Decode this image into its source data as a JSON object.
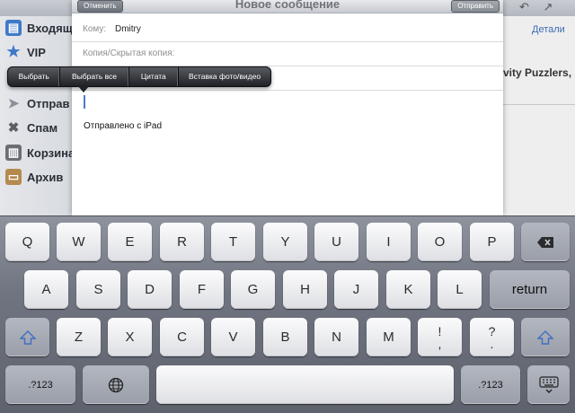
{
  "sidebar": {
    "folders": [
      {
        "label": "Входящ",
        "icon": "inbox-icon",
        "color": "#3f78c9"
      },
      {
        "label": "VIP",
        "icon": "star-icon",
        "color": "#3f78c9"
      },
      {
        "label": "Отправ",
        "icon": "paper-plane-icon",
        "color": "#8a8f98"
      },
      {
        "label": "Спам",
        "icon": "spam-icon",
        "color": "#5b5e63"
      },
      {
        "label": "Корзина",
        "icon": "trash-icon",
        "color": "#6b6e74"
      },
      {
        "label": "Архив",
        "icon": "archive-box-icon",
        "color": "#b48a4e"
      }
    ]
  },
  "background": {
    "details_link": "Детали",
    "snippet": "vity Puzzlers,"
  },
  "compose": {
    "title": "Новое сообщение",
    "cancel_label": "Отменить",
    "send_label": "Отправить",
    "to_label": "Кому:",
    "to_value": "Dmitry",
    "cc_label": "Копия/Скрытая копия:",
    "signature": "Отправлено с iPad"
  },
  "edit_menu": {
    "items": [
      "Выбрать",
      "Выбрать все",
      "Цитата",
      "Вставка фото/видео"
    ]
  },
  "keyboard": {
    "row1": [
      "Q",
      "W",
      "E",
      "R",
      "T",
      "Y",
      "U",
      "I",
      "O",
      "P"
    ],
    "row2": [
      "A",
      "S",
      "D",
      "F",
      "G",
      "H",
      "J",
      "K",
      "L"
    ],
    "row3": [
      "Z",
      "X",
      "C",
      "V",
      "B",
      "N",
      "M"
    ],
    "return_label": "return",
    "numbers_label": ".?123",
    "punct1": [
      "!",
      ","
    ],
    "punct2": [
      "?",
      "."
    ],
    "backspace_icon": "backspace-icon",
    "shift_icon": "shift-icon",
    "globe_icon": "globe-icon",
    "dismiss_icon": "keyboard-dismiss-icon"
  }
}
